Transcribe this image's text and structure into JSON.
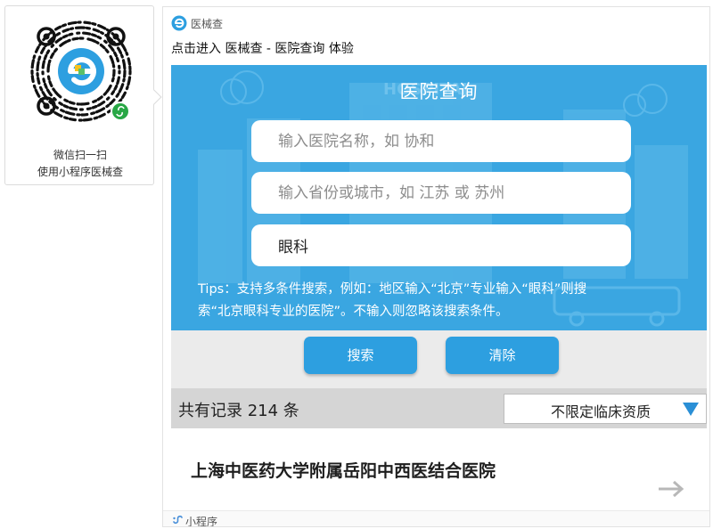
{
  "qr": {
    "caption_line1": "微信扫一扫",
    "caption_line2": "使用小程序医械查"
  },
  "card": {
    "brand_name": "医械查",
    "title": "点击进入 医械查 - 医院查询 体验",
    "footer": "小程序"
  },
  "hero": {
    "title": "医院查询",
    "watermark": "HOSPITAL",
    "hospital_name_placeholder": "输入医院名称，如 协和",
    "region_placeholder": "输入省份或城市，如 江苏 或 苏州",
    "specialty_value": "眼科",
    "tips_line1": "Tips：支持多条件搜索，例如：地区输入“北京”专业输入“眼科”则搜",
    "tips_line2": "索“北京眼科专业的医院”。不输入则忽略该搜索条件。"
  },
  "buttons": {
    "search": "搜索",
    "clear": "清除"
  },
  "results": {
    "count_text": "共有记录 214 条",
    "filter_selected": "不限定临床资质",
    "items": [
      {
        "name": "上海中医药大学附属岳阳中西医结合医院"
      }
    ]
  },
  "colors": {
    "accent": "#3aa6e1",
    "button": "#2d9fe0",
    "select_arrow": "#2a8fd6"
  },
  "icons": {
    "brand": "yixiecha-logo-icon",
    "result": "arrow-right-icon",
    "footer": "mini-program-icon"
  }
}
